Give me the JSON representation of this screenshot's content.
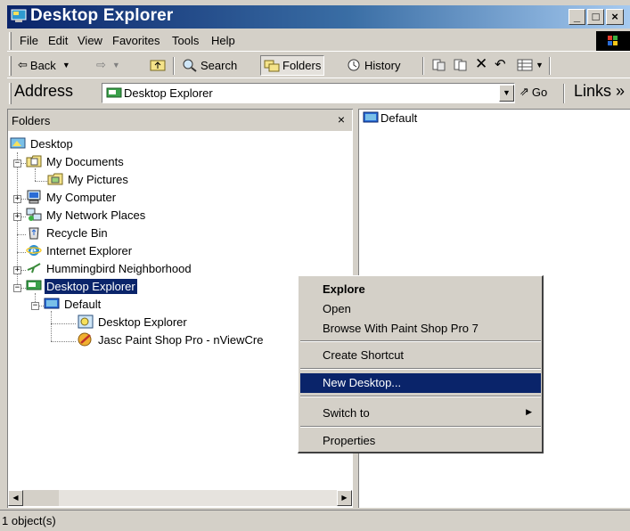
{
  "window": {
    "title": "Desktop Explorer"
  },
  "caption_buttons": {
    "minimize": "_",
    "maximize": "□",
    "close": "×"
  },
  "menu": [
    "File",
    "Edit",
    "View",
    "Favorites",
    "Tools",
    "Help"
  ],
  "toolbar": {
    "back": "Back",
    "search": "Search",
    "folders": "Folders",
    "history": "History"
  },
  "address": {
    "label": "Address",
    "value": "Desktop Explorer",
    "go": "Go",
    "links": "Links »"
  },
  "folders_pane": {
    "title": "Folders",
    "close": "×",
    "tree": [
      {
        "label": "Desktop",
        "icon": "desktop-icon"
      },
      {
        "label": "My Documents",
        "icon": "my-documents-icon"
      },
      {
        "label": "My Pictures",
        "icon": "my-pictures-icon"
      },
      {
        "label": "My Computer",
        "icon": "my-computer-icon"
      },
      {
        "label": "My Network Places",
        "icon": "network-places-icon"
      },
      {
        "label": "Recycle Bin",
        "icon": "recycle-bin-icon"
      },
      {
        "label": "Internet Explorer",
        "icon": "internet-explorer-icon"
      },
      {
        "label": "Hummingbird Neighborhood",
        "icon": "hummingbird-icon"
      },
      {
        "label": "Desktop Explorer",
        "icon": "desktop-explorer-icon",
        "selected": true
      },
      {
        "label": "Default",
        "icon": "desktop-folder-icon"
      },
      {
        "label": "Desktop Explorer",
        "icon": "desktop-explorer-shortcut-icon"
      },
      {
        "label": "Jasc Paint Shop Pro - nViewCre",
        "icon": "paint-shop-pro-icon"
      }
    ]
  },
  "content_pane": {
    "items": [
      {
        "label": "Default",
        "icon": "desktop-folder-icon"
      }
    ]
  },
  "context_menu": {
    "items": [
      {
        "label": "Explore",
        "bold": true
      },
      {
        "label": "Open"
      },
      {
        "label": "Browse With Paint Shop Pro 7"
      },
      {
        "label": "Create Shortcut"
      },
      {
        "label": "New Desktop...",
        "highlighted": true
      },
      {
        "label": "Switch to",
        "submenu": true
      },
      {
        "label": "Properties"
      }
    ]
  },
  "statusbar": {
    "text": "1 object(s)"
  },
  "colors": {
    "selection": "#0a246a",
    "face": "#d4d0c8",
    "titlebar_start": "#0a246a",
    "titlebar_end": "#a6caf0"
  }
}
